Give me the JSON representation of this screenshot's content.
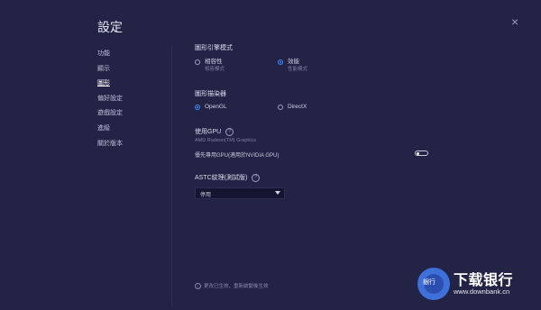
{
  "window": {
    "title": "設定",
    "close_glyph": "×"
  },
  "nav": {
    "items": [
      {
        "label": "功能",
        "active": false
      },
      {
        "label": "顯示",
        "active": false
      },
      {
        "label": "圖形",
        "active": true
      },
      {
        "label": "偏好設定",
        "active": false
      },
      {
        "label": "遊戲設定",
        "active": false
      },
      {
        "label": "進級",
        "active": false
      },
      {
        "label": "關於版本",
        "active": false
      }
    ]
  },
  "graphics_engine": {
    "title": "圖形引擎模式",
    "options": [
      {
        "label": "相容性",
        "sub": "相容模式",
        "selected": false
      },
      {
        "label": "效能",
        "sub": "性能模式",
        "selected": true
      }
    ]
  },
  "renderer": {
    "title": "圖形描染器",
    "options": [
      {
        "label": "OpenGL",
        "selected": true
      },
      {
        "label": "DirectX",
        "selected": false
      }
    ]
  },
  "gpu": {
    "title": "使用GPU",
    "name": "AMD Radeon(TM) Graphics",
    "toggle_label": "優先專用GPU(適用於NVIDIA GPU)",
    "toggle_on": false
  },
  "astc": {
    "title": "ASTC紋理(測試版)",
    "select_value": "停用"
  },
  "footer": {
    "note": "更改已生效，重新啟動後生效"
  },
  "watermark": {
    "brand": "下载银行",
    "url": "www.downbank.cn",
    "badge": "銀行"
  },
  "colors": {
    "background": "#232346",
    "accent": "#3f8cff"
  }
}
